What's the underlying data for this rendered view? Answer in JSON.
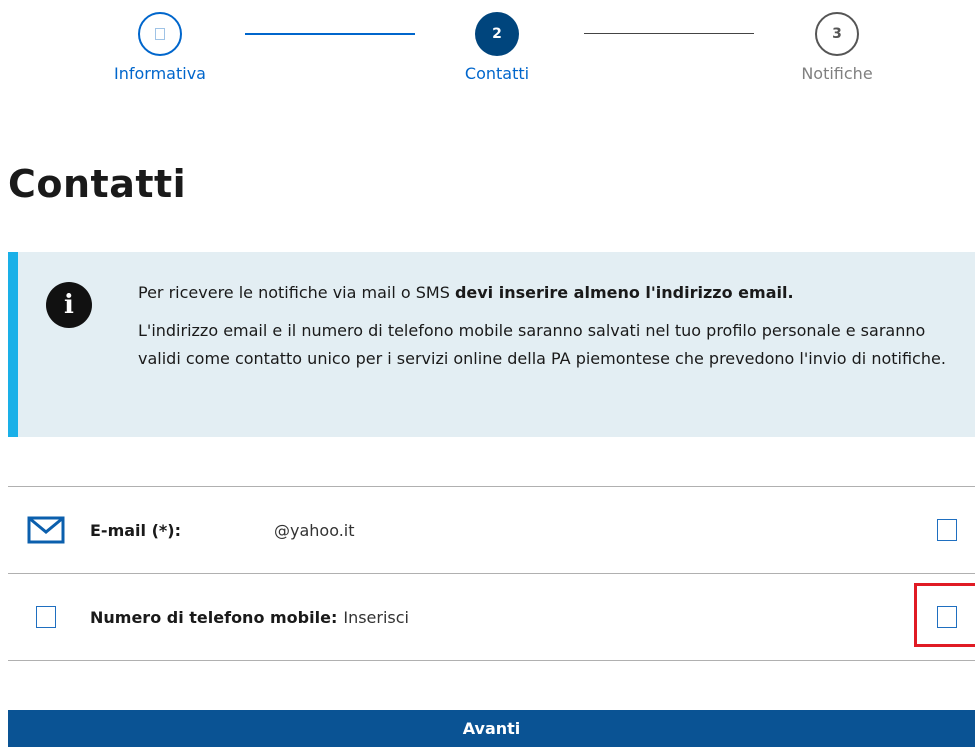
{
  "stepper": {
    "steps": [
      {
        "number": "",
        "label": "Informativa"
      },
      {
        "number": "2",
        "label": "Contatti"
      },
      {
        "number": "3",
        "label": "Notifiche"
      }
    ]
  },
  "page": {
    "title": "Contatti"
  },
  "callout": {
    "line1_prefix": "Per ricevere le notifiche via mail o SMS ",
    "line1_bold": "devi inserire almeno l'indirizzo email.",
    "line2": "L'indirizzo email e il numero di telefono mobile saranno salvati nel tuo profilo personale e saranno validi come contatto unico per i servizi online della PA piemontese che prevedono l'invio di notifiche."
  },
  "email_row": {
    "label": "E-mail (*):",
    "value": "@yahoo.it"
  },
  "phone_row": {
    "label": "Numero di telefono mobile:",
    "value": "Inserisci"
  },
  "actions": {
    "next_label": "Avanti"
  },
  "colors": {
    "primary": "#0a5394",
    "accent_blue": "#0066cc",
    "callout_bg": "#e3eef3",
    "callout_border": "#1ab0e8",
    "highlight": "#e01b24"
  }
}
